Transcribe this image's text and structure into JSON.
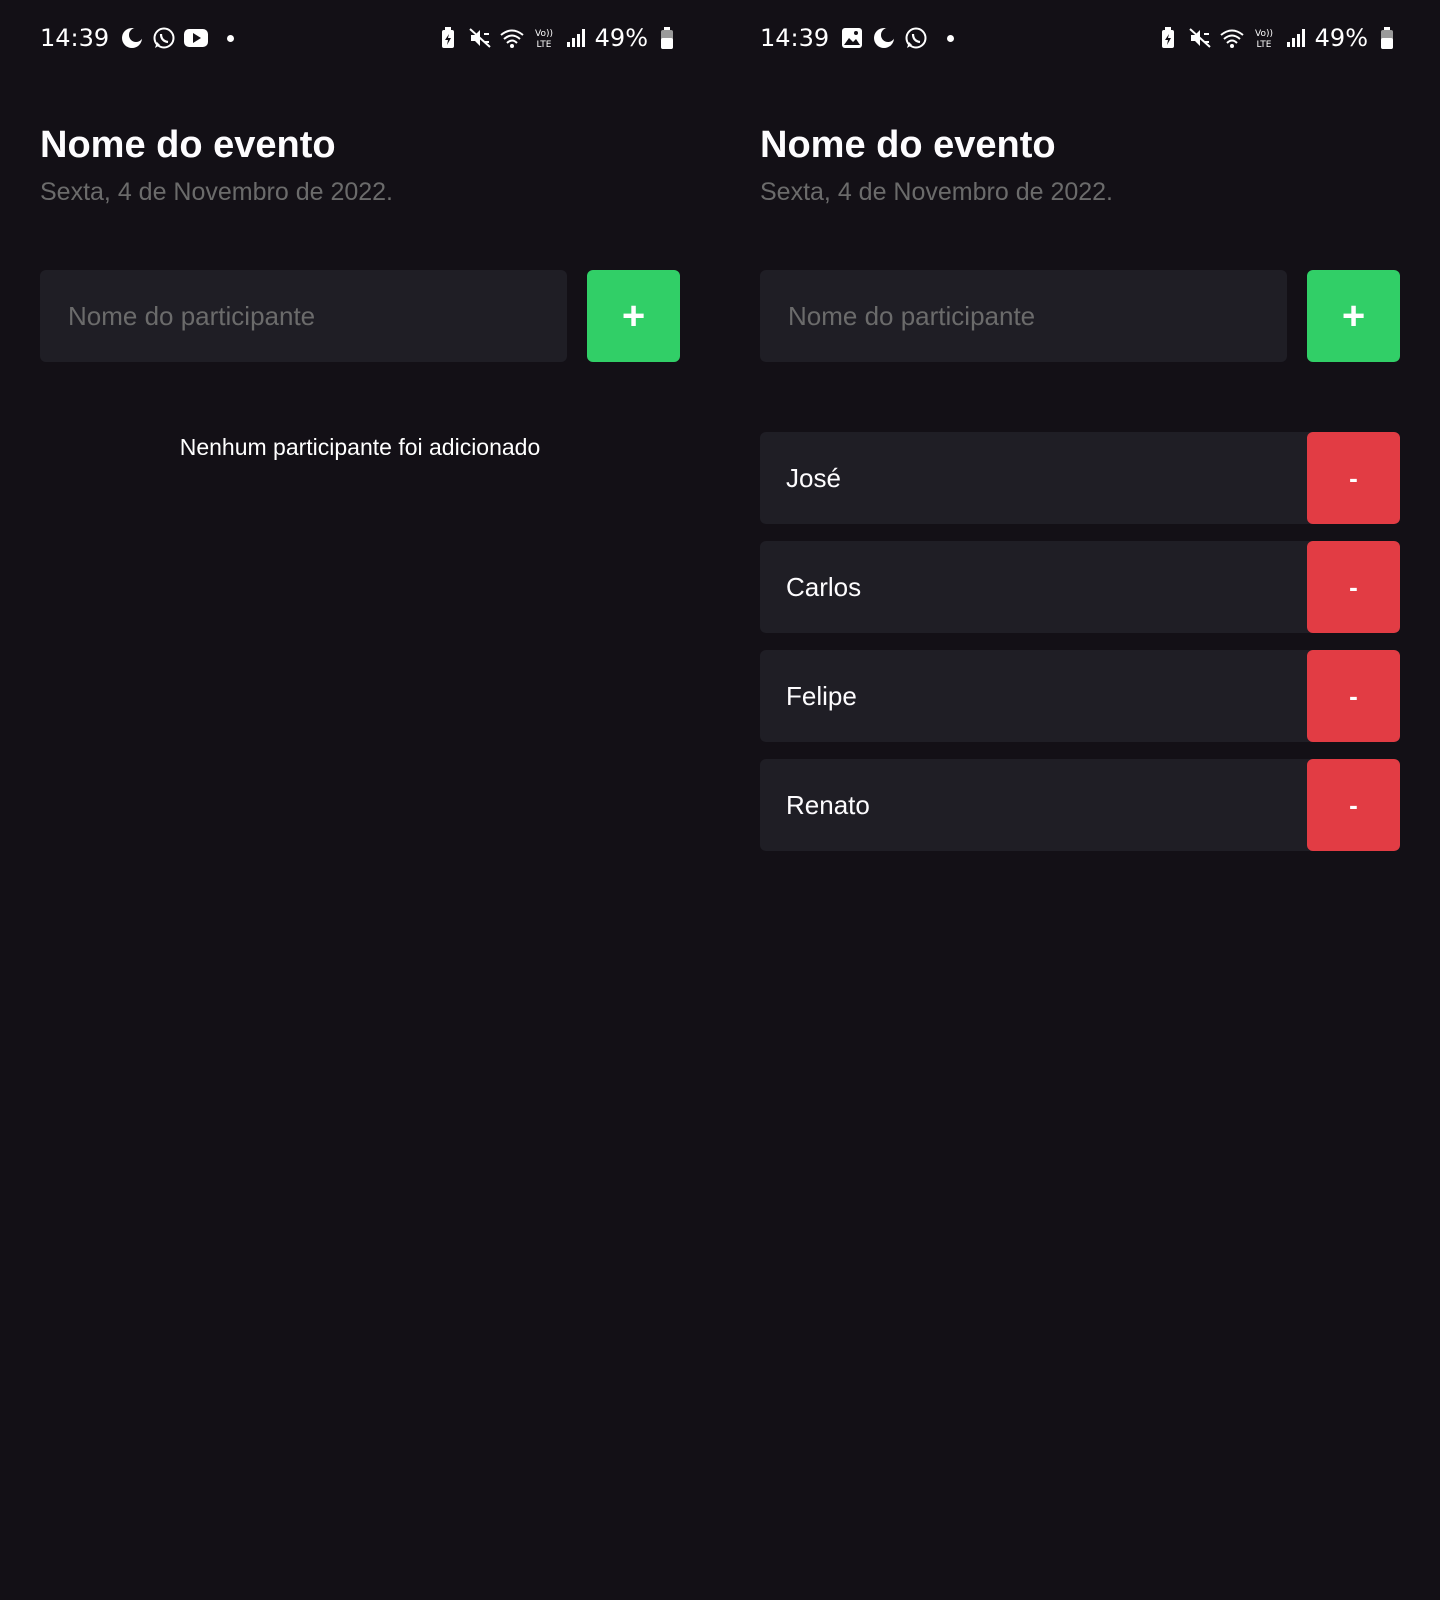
{
  "colors": {
    "background": "#131016",
    "surface": "#1F1E25",
    "add_button": "#31CF67",
    "remove_button": "#E23C44",
    "subtitle_text": "#6B6B6B"
  },
  "left_screen": {
    "status_bar": {
      "time": "14:39",
      "left_icons": [
        "moon-icon",
        "whatsapp-icon",
        "youtube-icon"
      ],
      "right_icons": [
        "battery-saver-icon",
        "mute-icon",
        "wifi-icon",
        "volte-icon",
        "signal-icon"
      ],
      "battery": "49%"
    },
    "event": {
      "title": "Nome do evento",
      "date": "Sexta, 4 de Novembro de 2022."
    },
    "form": {
      "placeholder": "Nome do participante",
      "add_label": "+"
    },
    "empty_message": "Nenhum participante foi adicionado"
  },
  "right_screen": {
    "status_bar": {
      "time": "14:39",
      "left_icons": [
        "gallery-icon",
        "moon-icon",
        "whatsapp-icon"
      ],
      "right_icons": [
        "battery-saver-icon",
        "mute-icon",
        "wifi-icon",
        "volte-icon",
        "signal-icon"
      ],
      "battery": "49%"
    },
    "event": {
      "title": "Nome do evento",
      "date": "Sexta, 4 de Novembro de 2022."
    },
    "form": {
      "placeholder": "Nome do participante",
      "add_label": "+"
    },
    "participants": [
      {
        "name": "José",
        "remove_label": "-"
      },
      {
        "name": "Carlos",
        "remove_label": "-"
      },
      {
        "name": "Felipe",
        "remove_label": "-"
      },
      {
        "name": "Renato",
        "remove_label": "-"
      }
    ]
  }
}
